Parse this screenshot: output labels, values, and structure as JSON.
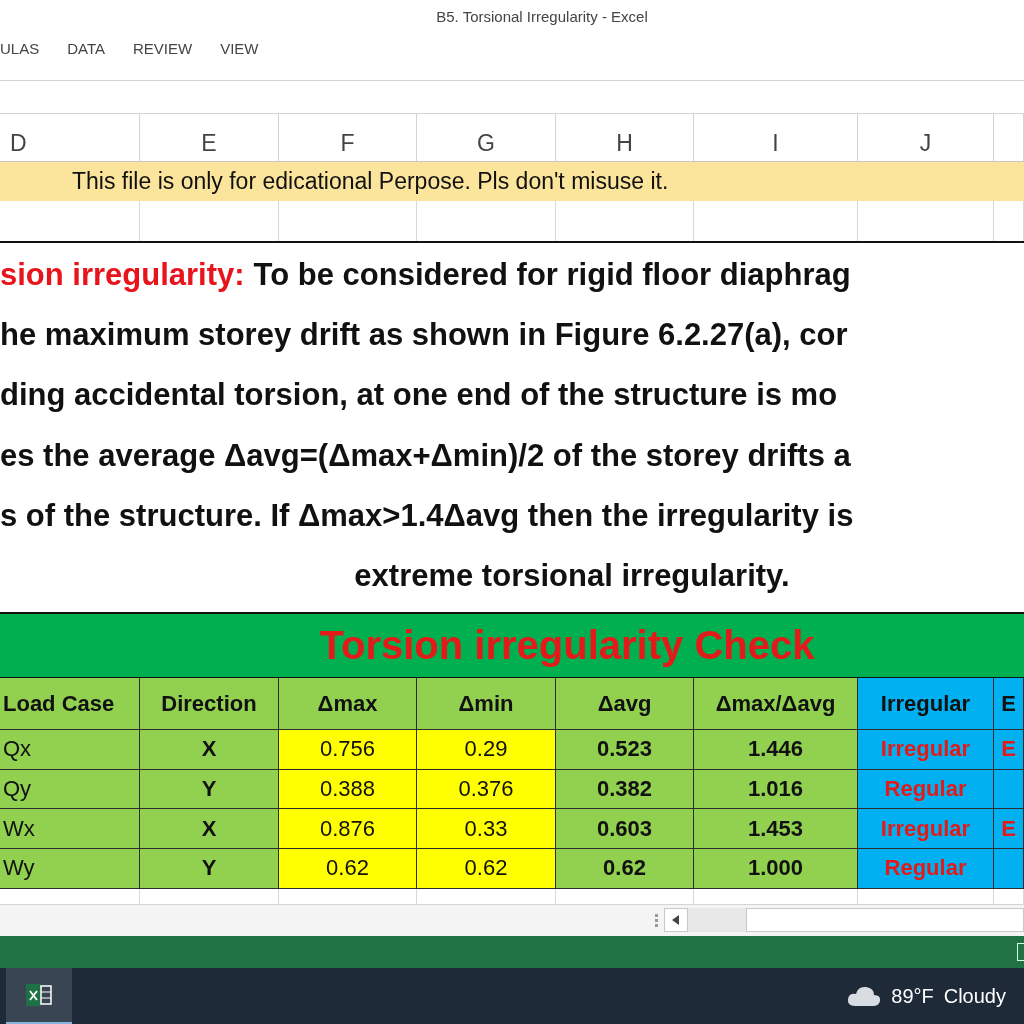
{
  "window": {
    "title": "B5. Torsional Irregularity - Excel"
  },
  "ribbon_tabs": [
    "ULAS",
    "DATA",
    "REVIEW",
    "VIEW"
  ],
  "column_headers": [
    "D",
    "E",
    "F",
    "G",
    "H",
    "I",
    "J"
  ],
  "banner": "This file is only for edicational Perpose. Pls don't misuse it.",
  "definition": {
    "lead": "sion irregularity:",
    "lines": [
      "To be considered for rigid floor diaphrag",
      "he maximum storey drift as shown in Figure 6.2.27(a), cor",
      "ding accidental torsion, at one end of the structure is mo",
      "es the average Δavg=(Δmax+Δmin)/2 of the storey drifts a",
      "s of the structure. If Δmax>1.4Δavg then the irregularity is",
      "extreme torsional irregularity."
    ]
  },
  "table": {
    "title": "Torsion irregularity Check",
    "columns": [
      {
        "label": "Load Case",
        "kind": "case"
      },
      {
        "label": "Direction",
        "kind": "bold"
      },
      {
        "label": "Δmax",
        "kind": "input"
      },
      {
        "label": "Δmin",
        "kind": "input"
      },
      {
        "label": "Δavg",
        "kind": "bold"
      },
      {
        "label": "Δmax/Δavg",
        "kind": "bold"
      },
      {
        "label": "Irregular",
        "kind": "result"
      },
      {
        "label": "E",
        "kind": "result"
      }
    ],
    "rows": [
      [
        "Qx",
        "X",
        "0.756",
        "0.29",
        "0.523",
        "1.446",
        "Irregular",
        "E"
      ],
      [
        "Qy",
        "Y",
        "0.388",
        "0.376",
        "0.382",
        "1.016",
        "Regular",
        ""
      ],
      [
        "Wx",
        "X",
        "0.876",
        "0.33",
        "0.603",
        "1.453",
        "Irregular",
        "E"
      ],
      [
        "Wy",
        "Y",
        "0.62",
        "0.62",
        "0.62",
        "1.000",
        "Regular",
        ""
      ]
    ]
  },
  "taskbar": {
    "apps": [
      {
        "selected": true
      }
    ],
    "temperature": "89°F",
    "weather": "Cloudy"
  }
}
